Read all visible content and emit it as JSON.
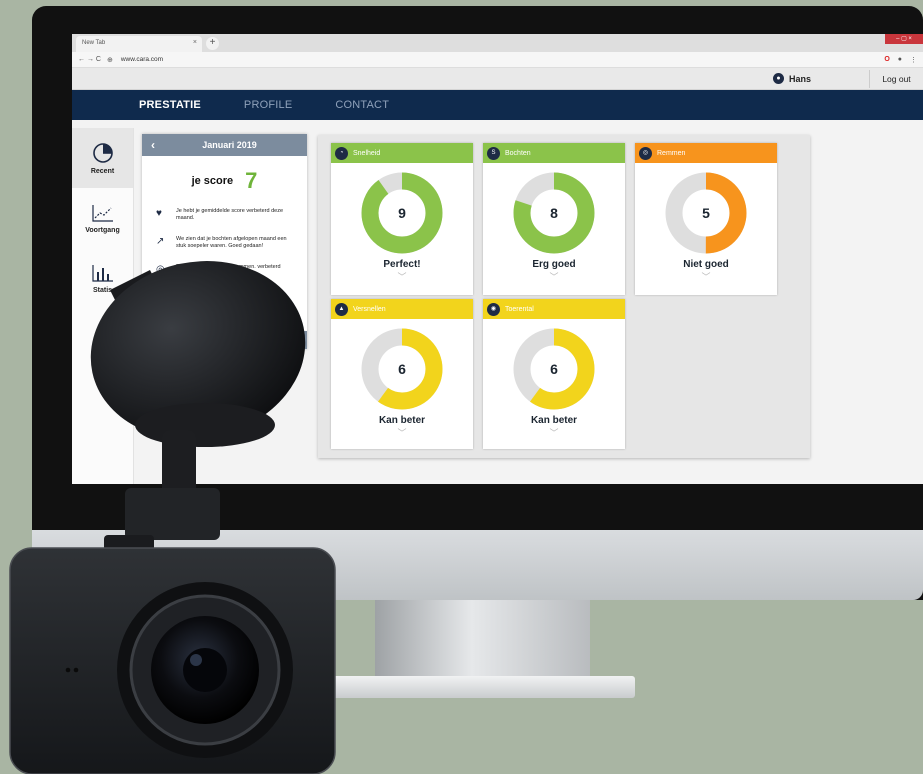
{
  "browser": {
    "tab_title": "New Tab",
    "tab_close": "×",
    "new_tab": "+",
    "window_controls": "– ▢ ×",
    "nav": "← → C",
    "url": "www.cara.com",
    "menu": "⋮"
  },
  "userbar": {
    "user_name": "Hans",
    "logout_label": "Log out"
  },
  "nav": {
    "items": [
      "PRESTATIE",
      "PROFILE",
      "CONTACT"
    ],
    "active": "PRESTATIE"
  },
  "sidebar": {
    "items": [
      {
        "label": "Recent",
        "icon": "pie-chart-icon"
      },
      {
        "label": "Voortgang",
        "icon": "line-chart-icon"
      },
      {
        "label": "Statis",
        "icon": "bar-chart-icon"
      }
    ]
  },
  "score_panel": {
    "month": "Januari 2019",
    "score_label": "je score",
    "score_value": "7",
    "messages": [
      {
        "icon": "heart-icon",
        "text": "Je hebt je gemiddelde score verbeterd deze maand."
      },
      {
        "icon": "curve-arrow-icon",
        "text": "We zien dat je bochten afgelopen maand een stuk soepeler waren. Goed gedaan!"
      },
      {
        "icon": "brake-icon",
        "text": "Probeer minder hard te remmen. verbeterd worden aand."
      }
    ]
  },
  "cards": [
    {
      "title": "Snelheid",
      "value": "9",
      "max": 10,
      "label": "Perfect!",
      "icon": "speedometer-icon",
      "color": "#8bc34a"
    },
    {
      "title": "Bochten",
      "value": "8",
      "max": 10,
      "label": "Erg goed",
      "icon": "curve-sign-icon",
      "color": "#8bc34a"
    },
    {
      "title": "Remmen",
      "value": "5",
      "max": 10,
      "label": "Niet goed",
      "icon": "brake-disc-icon",
      "color": "#f7941d"
    },
    {
      "title": "Versnellen",
      "value": "6",
      "max": 10,
      "label": "Kan beter",
      "icon": "accelerate-icon",
      "color": "#f2d41c"
    },
    {
      "title": "Toerental",
      "value": "6",
      "max": 10,
      "label": "Kan beter",
      "icon": "rpm-gauge-icon",
      "color": "#f2d41c"
    }
  ],
  "colors": {
    "navbar": "#0f2a4d",
    "green": "#8bc34a",
    "orange": "#f7941d",
    "yellow": "#f2d41c",
    "ring_bg": "#dedede"
  }
}
